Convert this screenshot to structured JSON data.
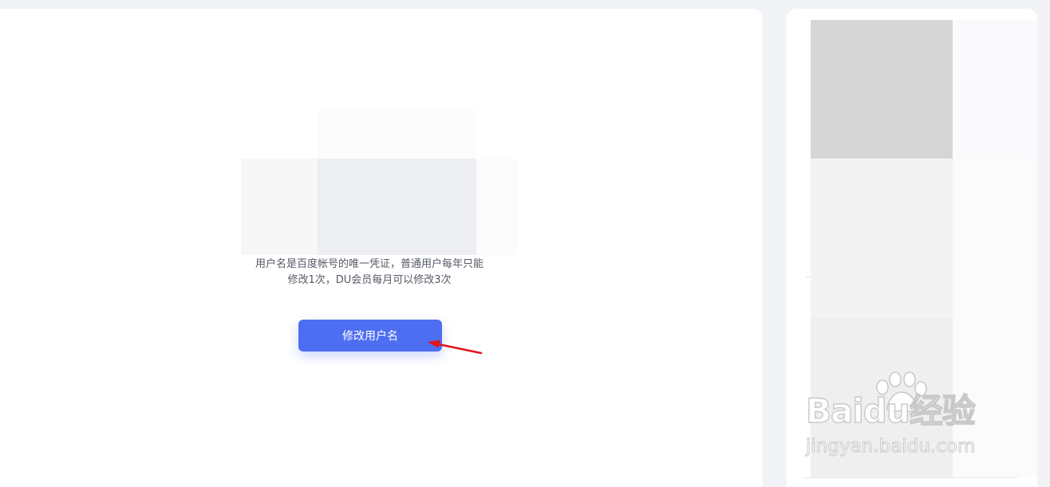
{
  "username_panel": {
    "description_line1": "用户名是百度帐号的唯一凭证，普通用户每年只能",
    "description_line2": "修改1次，DU会员每月可以修改3次",
    "change_button_label": "修改用户名"
  },
  "watermark": {
    "logo_text": "Baidu经验",
    "url_text": "jingyan.baidu.com"
  },
  "colors": {
    "primary": "#4e6ef2",
    "annotation_arrow": "#e0151b",
    "page_background": "#f2f3f7"
  },
  "icons": {
    "annotation": "red-arrow-icon",
    "watermark": "baidu-paw-icon"
  }
}
